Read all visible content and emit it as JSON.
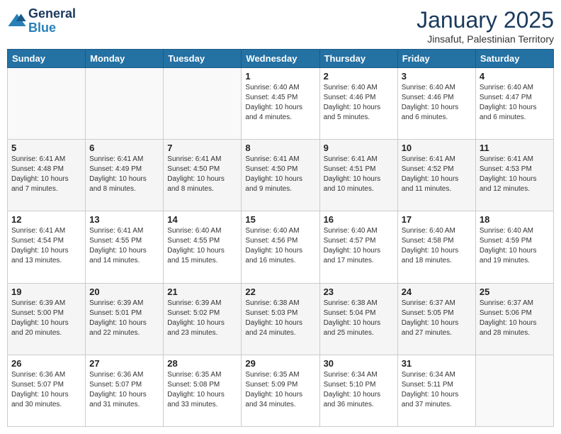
{
  "header": {
    "logo_line1": "General",
    "logo_line2": "Blue",
    "title": "January 2025",
    "subtitle": "Jinsafut, Palestinian Territory"
  },
  "weekdays": [
    "Sunday",
    "Monday",
    "Tuesday",
    "Wednesday",
    "Thursday",
    "Friday",
    "Saturday"
  ],
  "weeks": [
    [
      {
        "day": "",
        "info": ""
      },
      {
        "day": "",
        "info": ""
      },
      {
        "day": "",
        "info": ""
      },
      {
        "day": "1",
        "info": "Sunrise: 6:40 AM\nSunset: 4:45 PM\nDaylight: 10 hours\nand 4 minutes."
      },
      {
        "day": "2",
        "info": "Sunrise: 6:40 AM\nSunset: 4:46 PM\nDaylight: 10 hours\nand 5 minutes."
      },
      {
        "day": "3",
        "info": "Sunrise: 6:40 AM\nSunset: 4:46 PM\nDaylight: 10 hours\nand 6 minutes."
      },
      {
        "day": "4",
        "info": "Sunrise: 6:40 AM\nSunset: 4:47 PM\nDaylight: 10 hours\nand 6 minutes."
      }
    ],
    [
      {
        "day": "5",
        "info": "Sunrise: 6:41 AM\nSunset: 4:48 PM\nDaylight: 10 hours\nand 7 minutes."
      },
      {
        "day": "6",
        "info": "Sunrise: 6:41 AM\nSunset: 4:49 PM\nDaylight: 10 hours\nand 8 minutes."
      },
      {
        "day": "7",
        "info": "Sunrise: 6:41 AM\nSunset: 4:50 PM\nDaylight: 10 hours\nand 8 minutes."
      },
      {
        "day": "8",
        "info": "Sunrise: 6:41 AM\nSunset: 4:50 PM\nDaylight: 10 hours\nand 9 minutes."
      },
      {
        "day": "9",
        "info": "Sunrise: 6:41 AM\nSunset: 4:51 PM\nDaylight: 10 hours\nand 10 minutes."
      },
      {
        "day": "10",
        "info": "Sunrise: 6:41 AM\nSunset: 4:52 PM\nDaylight: 10 hours\nand 11 minutes."
      },
      {
        "day": "11",
        "info": "Sunrise: 6:41 AM\nSunset: 4:53 PM\nDaylight: 10 hours\nand 12 minutes."
      }
    ],
    [
      {
        "day": "12",
        "info": "Sunrise: 6:41 AM\nSunset: 4:54 PM\nDaylight: 10 hours\nand 13 minutes."
      },
      {
        "day": "13",
        "info": "Sunrise: 6:41 AM\nSunset: 4:55 PM\nDaylight: 10 hours\nand 14 minutes."
      },
      {
        "day": "14",
        "info": "Sunrise: 6:40 AM\nSunset: 4:55 PM\nDaylight: 10 hours\nand 15 minutes."
      },
      {
        "day": "15",
        "info": "Sunrise: 6:40 AM\nSunset: 4:56 PM\nDaylight: 10 hours\nand 16 minutes."
      },
      {
        "day": "16",
        "info": "Sunrise: 6:40 AM\nSunset: 4:57 PM\nDaylight: 10 hours\nand 17 minutes."
      },
      {
        "day": "17",
        "info": "Sunrise: 6:40 AM\nSunset: 4:58 PM\nDaylight: 10 hours\nand 18 minutes."
      },
      {
        "day": "18",
        "info": "Sunrise: 6:40 AM\nSunset: 4:59 PM\nDaylight: 10 hours\nand 19 minutes."
      }
    ],
    [
      {
        "day": "19",
        "info": "Sunrise: 6:39 AM\nSunset: 5:00 PM\nDaylight: 10 hours\nand 20 minutes."
      },
      {
        "day": "20",
        "info": "Sunrise: 6:39 AM\nSunset: 5:01 PM\nDaylight: 10 hours\nand 22 minutes."
      },
      {
        "day": "21",
        "info": "Sunrise: 6:39 AM\nSunset: 5:02 PM\nDaylight: 10 hours\nand 23 minutes."
      },
      {
        "day": "22",
        "info": "Sunrise: 6:38 AM\nSunset: 5:03 PM\nDaylight: 10 hours\nand 24 minutes."
      },
      {
        "day": "23",
        "info": "Sunrise: 6:38 AM\nSunset: 5:04 PM\nDaylight: 10 hours\nand 25 minutes."
      },
      {
        "day": "24",
        "info": "Sunrise: 6:37 AM\nSunset: 5:05 PM\nDaylight: 10 hours\nand 27 minutes."
      },
      {
        "day": "25",
        "info": "Sunrise: 6:37 AM\nSunset: 5:06 PM\nDaylight: 10 hours\nand 28 minutes."
      }
    ],
    [
      {
        "day": "26",
        "info": "Sunrise: 6:36 AM\nSunset: 5:07 PM\nDaylight: 10 hours\nand 30 minutes."
      },
      {
        "day": "27",
        "info": "Sunrise: 6:36 AM\nSunset: 5:07 PM\nDaylight: 10 hours\nand 31 minutes."
      },
      {
        "day": "28",
        "info": "Sunrise: 6:35 AM\nSunset: 5:08 PM\nDaylight: 10 hours\nand 33 minutes."
      },
      {
        "day": "29",
        "info": "Sunrise: 6:35 AM\nSunset: 5:09 PM\nDaylight: 10 hours\nand 34 minutes."
      },
      {
        "day": "30",
        "info": "Sunrise: 6:34 AM\nSunset: 5:10 PM\nDaylight: 10 hours\nand 36 minutes."
      },
      {
        "day": "31",
        "info": "Sunrise: 6:34 AM\nSunset: 5:11 PM\nDaylight: 10 hours\nand 37 minutes."
      },
      {
        "day": "",
        "info": ""
      }
    ]
  ]
}
